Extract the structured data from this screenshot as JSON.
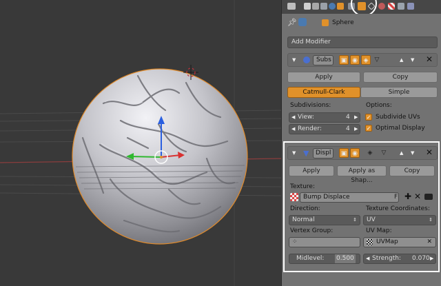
{
  "tabs": {
    "icons": [
      "render-icon",
      "render-layers-icon",
      "scene-icon",
      "world-icon",
      "object-icon",
      "constraints-icon",
      "modifiers-wrench-icon",
      "data-icon",
      "material-icon",
      "texture-icon",
      "particles-icon",
      "physics-icon"
    ],
    "active": "modifiers-wrench-icon"
  },
  "context": {
    "object_name": "Sphere"
  },
  "add_modifier_label": "Add Modifier",
  "subsurf": {
    "name": "Subs",
    "apply_label": "Apply",
    "copy_label": "Copy",
    "catmull_clark_label": "Catmull-Clark",
    "simple_label": "Simple",
    "subdivisions_label": "Subdivisions:",
    "view_label": "View:",
    "view_value": "4",
    "render_label": "Render:",
    "render_value": "4",
    "options_label": "Options:",
    "subdivide_uvs_label": "Subdivide UVs",
    "optimal_display_label": "Optimal Display"
  },
  "displace": {
    "name": "Displ",
    "apply_label": "Apply",
    "apply_as_shape_label": "Apply as Shap...",
    "copy_label": "Copy",
    "texture_label": "Texture:",
    "texture_name": "Bump Displace",
    "fake_user": "F",
    "direction_label": "Direction:",
    "direction_value": "Normal",
    "texture_coords_label": "Texture Coordinates:",
    "texture_coords_value": "UV",
    "vertex_group_label": "Vertex Group:",
    "uv_map_label": "UV Map:",
    "uv_map_value": "UVMap",
    "midlevel_label": "Midlevel:",
    "midlevel_value": "0.500",
    "strength_label": "Strength:",
    "strength_value": "0.070"
  },
  "colors": {
    "accent_orange": "#e0912a",
    "panel_bg": "#727272",
    "viewport_bg": "#393939",
    "highlight_outline": "#ffffff"
  }
}
